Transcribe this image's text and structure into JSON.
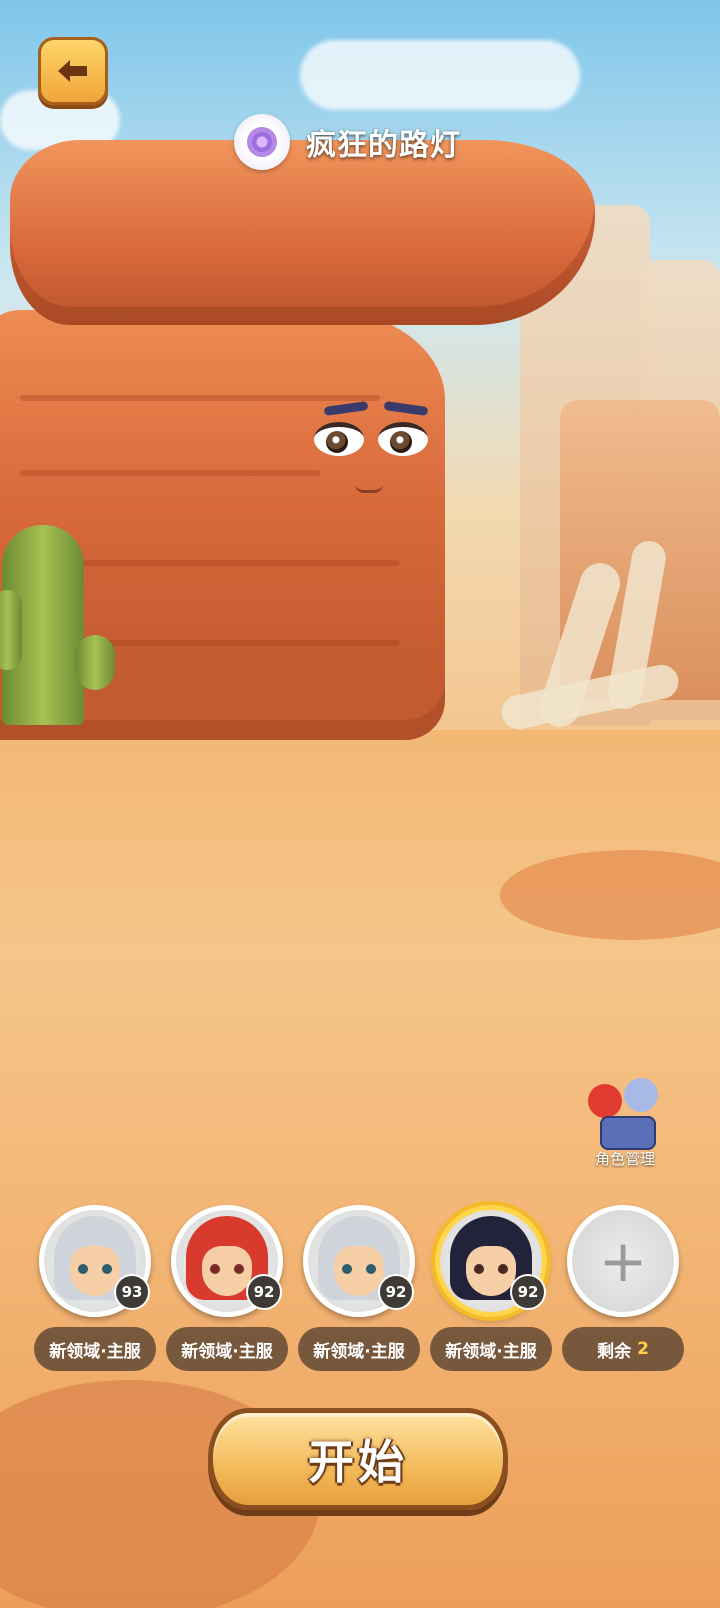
{
  "header": {
    "back_icon": "back-arrow-icon",
    "title": "疯狂的路灯",
    "title_icon": "purple-orb-icon"
  },
  "character_management": {
    "label": "角色管理"
  },
  "slots": [
    {
      "level": "93",
      "server": "新领域·主服",
      "hair_color": "#cfd3da",
      "active": false
    },
    {
      "level": "92",
      "server": "新领域·主服",
      "hair_color": "#d83a2e",
      "active": false
    },
    {
      "level": "92",
      "server": "新领域·主服",
      "hair_color": "#cfd3da",
      "active": false
    },
    {
      "level": "92",
      "server": "新领域·主服",
      "hair_color": "#22223a",
      "active": true
    }
  ],
  "add_slot": {
    "icon": "plus-icon",
    "remaining_label": "剩余",
    "remaining_count": "2"
  },
  "start_button": {
    "label": "开始"
  },
  "colors": {
    "accent_gold": "#f6b928",
    "tag_bg": "#564030",
    "remaining_highlight": "#ffd24a"
  }
}
